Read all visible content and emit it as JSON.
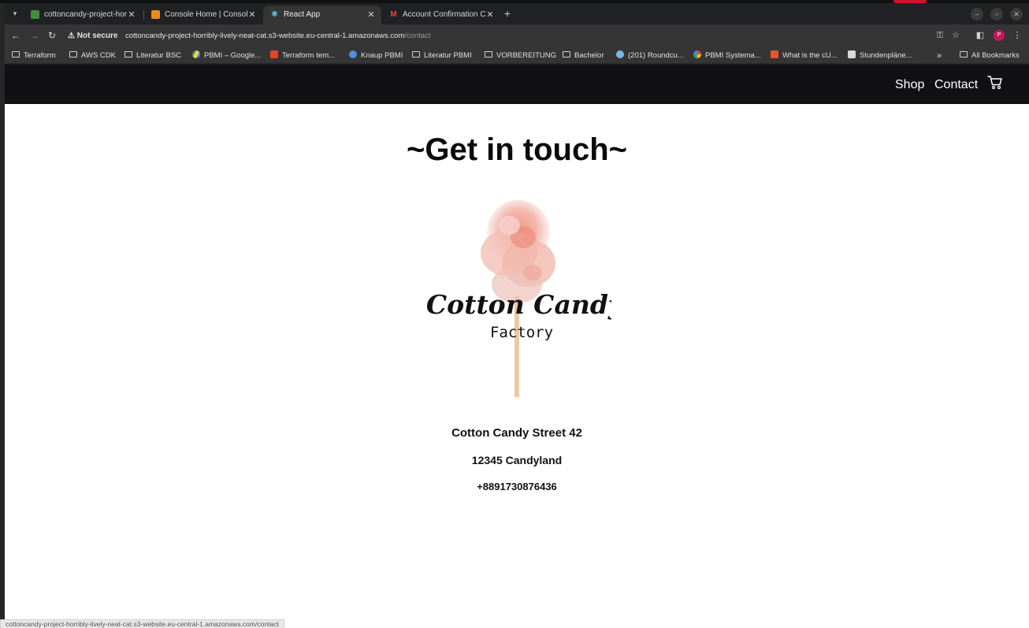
{
  "browser": {
    "tabs": [
      {
        "title": "cottoncandy-project-hor",
        "favicon_color": "#3f8f3f",
        "active": false
      },
      {
        "title": "Console Home | Console",
        "favicon_color": "#f0891c",
        "active": false
      },
      {
        "title": "React App",
        "favicon_color": "#61dafb",
        "active": true
      },
      {
        "title": "Account Confirmation C",
        "favicon_color": "#ea4335",
        "active": false
      }
    ],
    "security_label": "Not secure",
    "url_host": "cottoncandy-project-horribly-lively-neat-cat.s3-website.eu-central-1.amazonaws.com",
    "url_path": "/contact",
    "profile_initial": "P",
    "bookmarks": [
      {
        "label": "Terraform",
        "icon": "folder-icon"
      },
      {
        "label": "AWS CDK",
        "icon": "folder-icon"
      },
      {
        "label": "Literatur BSC",
        "icon": "folder-icon"
      },
      {
        "label": "PBMI – Google...",
        "icon": "drive-icon"
      },
      {
        "label": "Terraform tem...",
        "icon": "gitlab-icon"
      },
      {
        "label": "Knaup PBMI",
        "icon": "link-icon"
      },
      {
        "label": "Literatur PBMI",
        "icon": "folder-icon"
      },
      {
        "label": "VORBEREITUNG",
        "icon": "folder-icon"
      },
      {
        "label": "Bachelor",
        "icon": "folder-icon"
      },
      {
        "label": "(201) Roundcu...",
        "icon": "globe-icon"
      },
      {
        "label": "PBMI Systema...",
        "icon": "google-icon"
      },
      {
        "label": "What is the cU...",
        "icon": "page-icon"
      },
      {
        "label": "Stundenpläne...",
        "icon": "page-icon"
      }
    ],
    "overflow_label": "»",
    "all_bookmarks_label": "All Bookmarks",
    "status_url": "cottoncandy-project-horribly-lively-neat-cat.s3-website.eu-central-1.amazonaws.com/contact"
  },
  "page": {
    "nav": {
      "shop_label": "Shop",
      "contact_label": "Contact",
      "cart_icon": "cart-icon"
    },
    "heading": "~Get in touch~",
    "logo": {
      "line1": "Cotton Candy",
      "line2": "Factory"
    },
    "address": {
      "street": "Cotton Candy Street 42",
      "city": "12345 Candyland",
      "phone": "+8891730876436"
    }
  },
  "colors": {
    "navbar_bg": "#111013",
    "page_bg": "#ffffff",
    "accent": "#d1122a"
  }
}
